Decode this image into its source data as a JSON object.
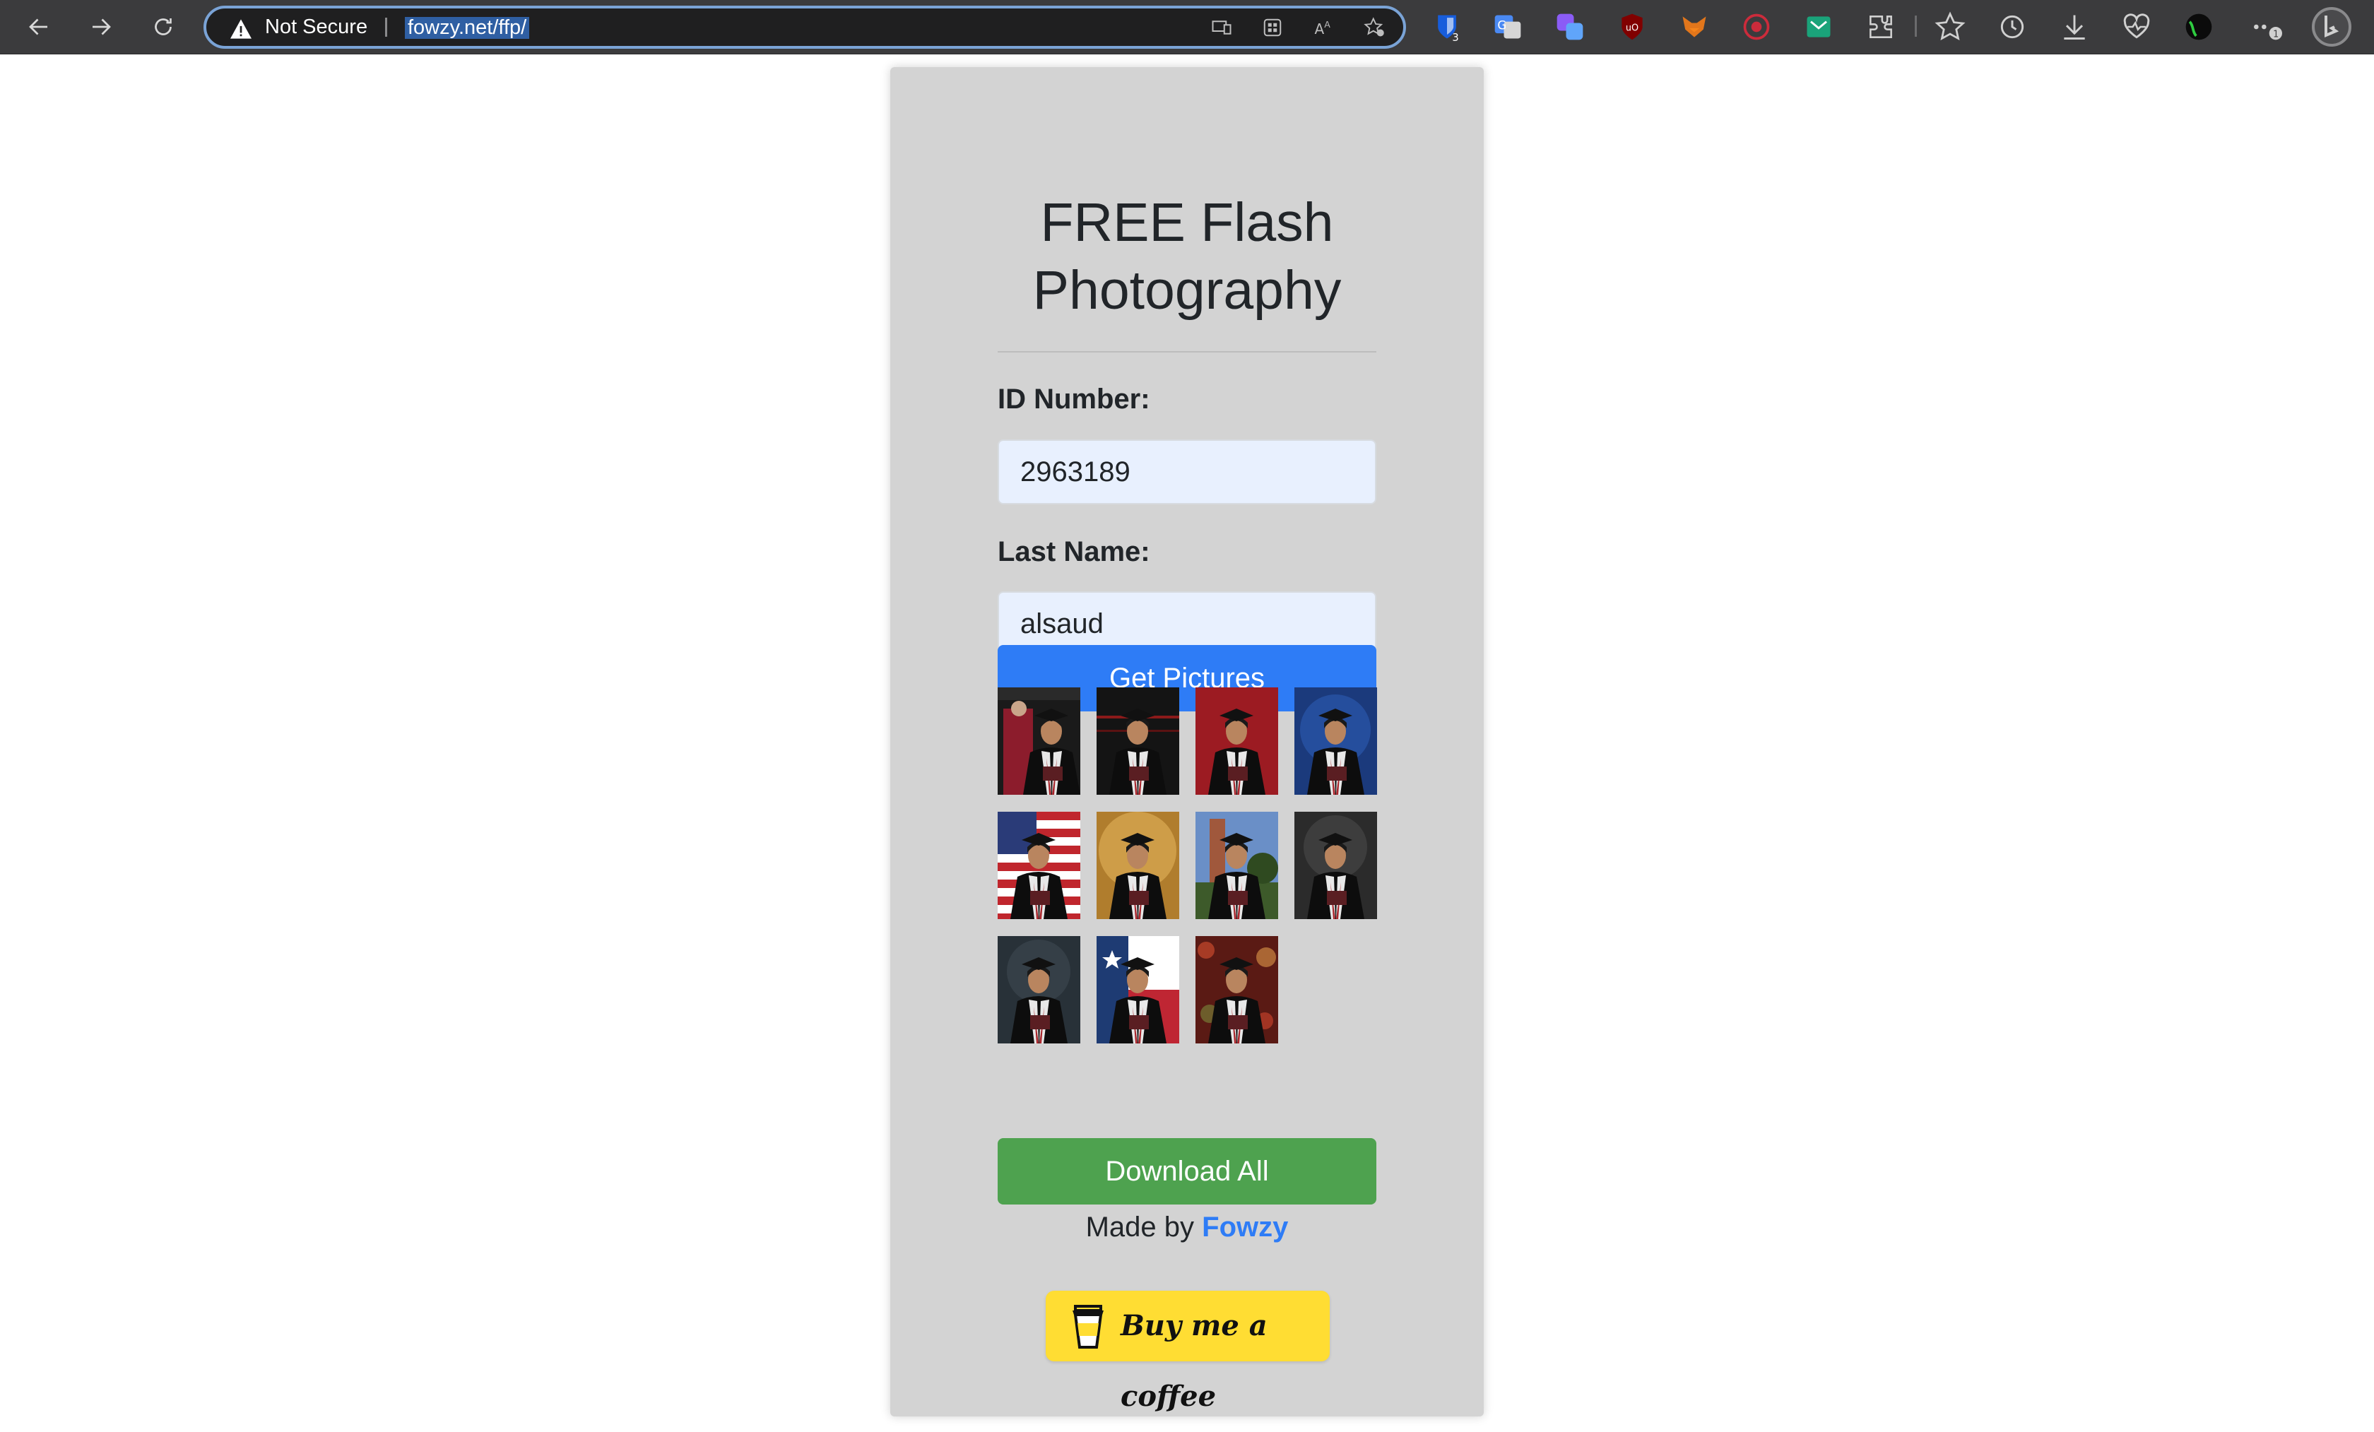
{
  "browser": {
    "security_label": "Not Secure",
    "url": "fowzy.net/ffp/",
    "extension_badges": {
      "bitwarden": "3",
      "menu": "1"
    }
  },
  "page": {
    "title": "FREE Flash Photography",
    "id_label": "ID Number:",
    "id_value": "2963189",
    "last_name_label": "Last Name:",
    "last_name_value": "alsaud",
    "get_pictures_label": "Get Pictures",
    "photos": [
      {
        "bg": "dean-handshake"
      },
      {
        "bg": "black-stage"
      },
      {
        "bg": "maroon"
      },
      {
        "bg": "blue"
      },
      {
        "bg": "us-flag"
      },
      {
        "bg": "gold"
      },
      {
        "bg": "campus-tower"
      },
      {
        "bg": "dark-gray"
      },
      {
        "bg": "slate"
      },
      {
        "bg": "texas-flag"
      },
      {
        "bg": "red-bokeh"
      }
    ],
    "download_all_label": "Download All",
    "made_by_prefix": "Made by",
    "made_by_link": "Fowzy",
    "coffee_label": "Buy me a coffee"
  },
  "colors": {
    "primary": "#2e7cf6",
    "success": "#4ea24f",
    "card": "#d3d3d3",
    "coffee": "#ffdd33",
    "input": "#e8f0fe"
  }
}
